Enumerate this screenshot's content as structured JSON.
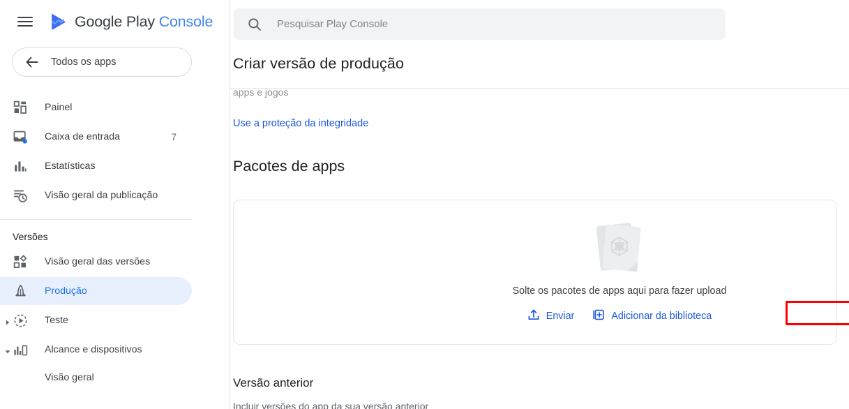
{
  "brand": {
    "menu_icon": "hamburger-icon",
    "logo_icon": "google-play-logo-icon",
    "name_primary": "Google Play",
    "name_secondary": "Console"
  },
  "sidebar": {
    "back_button": {
      "icon": "arrow-left-icon",
      "label": "Todos os apps"
    },
    "items": [
      {
        "icon": "dashboard-icon",
        "label": "Painel",
        "badge": "",
        "selected": false
      },
      {
        "icon": "inbox-icon",
        "label": "Caixa de entrada",
        "badge": "7",
        "selected": false
      },
      {
        "icon": "statistics-bar-chart-icon",
        "label": "Estatísticas",
        "badge": "",
        "selected": false
      },
      {
        "icon": "publishing-overview-clock-icon",
        "label": "Visão geral da publicação",
        "badge": "",
        "selected": false
      }
    ],
    "section_title": "Versões",
    "release_items": [
      {
        "icon": "releases-overview-icon",
        "label": "Visão geral das versões",
        "selected": false,
        "twisty": ""
      },
      {
        "icon": "rocket-icon",
        "label": "Produção",
        "selected": true,
        "twisty": ""
      },
      {
        "icon": "testing-play-circle-icon",
        "label": "Teste",
        "selected": false,
        "twisty": "chevron-right-icon"
      },
      {
        "icon": "reach-devices-icon",
        "label": "Alcance e dispositivos",
        "selected": false,
        "twisty": "chevron-down-icon"
      }
    ],
    "sub_items": [
      {
        "label": "Visão geral"
      }
    ]
  },
  "search": {
    "icon": "search-icon",
    "placeholder": "Pesquisar Play Console",
    "value": ""
  },
  "main": {
    "page_title": "Criar versão de produção",
    "scrolled_text": "apps e jogos",
    "integrity_link": "Use a proteção da integridade",
    "packages_heading": "Pacotes de apps",
    "dropzone": {
      "illustration_icon": "app-bundle-files-icon",
      "text": "Solte os pacotes de apps aqui para fazer upload",
      "upload_button": {
        "icon": "upload-icon",
        "label": "Enviar"
      },
      "library_button": {
        "icon": "add-from-library-icon",
        "label": "Adicionar da biblioteca"
      }
    },
    "previous_version": {
      "heading": "Versão anterior",
      "subtext": "Incluir versões do app da sua versão anterior"
    }
  },
  "colors": {
    "accent_blue": "#1a73e8",
    "link_blue": "#1a56db",
    "selected_pill": "#e8f0fe",
    "highlight_red": "#ff0000",
    "search_bg": "#f1f3f4"
  }
}
